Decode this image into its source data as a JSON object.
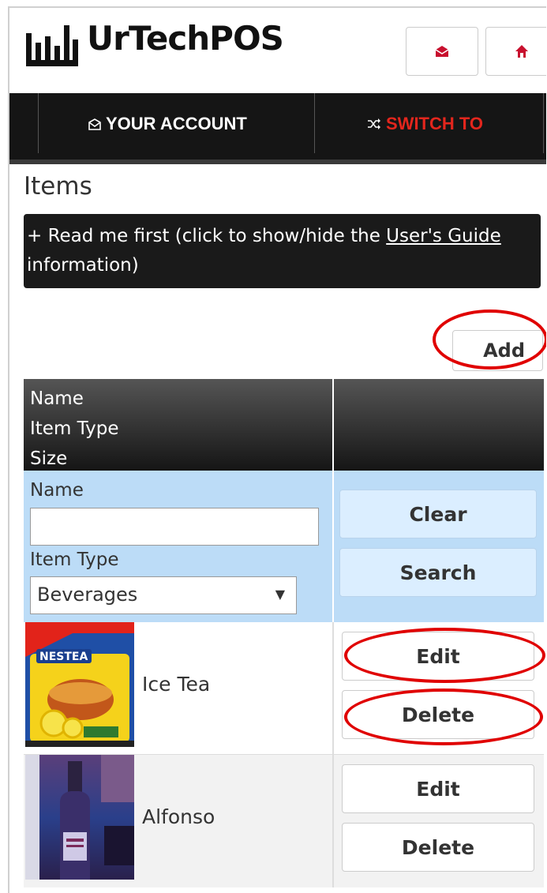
{
  "app": {
    "title": "UrTechPOS"
  },
  "header": {
    "buttons": [
      {
        "icon": "envelope-icon"
      },
      {
        "icon": "home-icon"
      }
    ]
  },
  "nav": {
    "items": [
      {
        "label": "YOUR ACCOUNT",
        "icon": "envelope-icon",
        "color": "#ffffff"
      },
      {
        "label": "SWITCH TO",
        "icon": "shuffle-icon",
        "color": "#e3261d"
      }
    ]
  },
  "page": {
    "title": "Items",
    "guide": {
      "prefix": "+ Read me first (click to show/hide the ",
      "link": "User's Guide",
      "suffix": " information)"
    },
    "add_label": "Add"
  },
  "table": {
    "headers": [
      "Name",
      "Item Type",
      "Size"
    ],
    "filter": {
      "name_label": "Name",
      "name_value": "",
      "type_label": "Item Type",
      "type_value": "Beverages",
      "clear_label": "Clear",
      "search_label": "Search"
    },
    "rows": [
      {
        "name": "Ice Tea",
        "edit_label": "Edit",
        "delete_label": "Delete"
      },
      {
        "name": "Alfonso",
        "edit_label": "Edit",
        "delete_label": "Delete"
      }
    ]
  },
  "colors": {
    "annotation": "#e00000",
    "nav_bg": "#151515",
    "filter_bg": "#bcdcf7",
    "accent_red": "#e3261d"
  }
}
